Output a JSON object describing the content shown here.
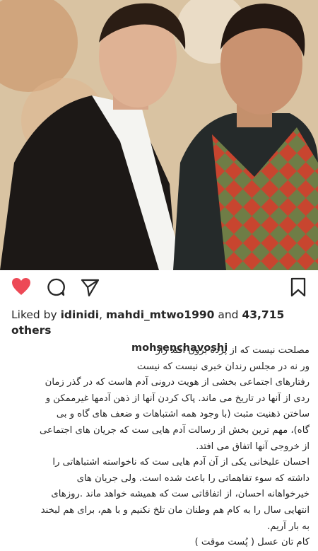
{
  "post": {
    "likes_prefix": "Liked by ",
    "liker_1": "idinidi",
    "sep": ", ",
    "liker_2": "mahdi_mtwo1990",
    "and": " and ",
    "count": "43,715",
    "others": "others",
    "username": "mohsenchavoshi",
    "caption_lines": [
      "مصلحت نیست که از پرده برون افتد راز",
      "ور نه در مجلس رندان خبری نیست که نیست",
      "رفتارهای اجتماعی بخشی از هویت درونی آدم هاست که در گذر زمان",
      "ردی از آنها در تاریخ می ماند. پاک کردن آنها از ذهن آدمها غیرممکن و",
      "ساختن ذهنیت مثبت (با وجود همه اشتباهات و ضعف های گاه و بی",
      "گاه)، مهم ترین بخش از رسالت آدم هایی ست که جریان های اجتماعی",
      "از خروجی آنها اتفاق می افتد.",
      "احسان علیخانی یکی از آن آدم هایی ست که ناخواسته اشتباهاتی را",
      "داشته که سوء تفاهماتی را باعث شده است. ولی جریان های",
      "خیرخواهانه احسان، از اتفاقاتی ست که همیشه خواهد ماند .روزهای",
      "انتهایی سال را به کام هم وطنان مان تلخ نکنیم و با هم، برای هم لبخند",
      "به بار آریم.",
      "کام تان عسل ( پُست موقت )"
    ]
  },
  "colors": {
    "heart": "#ed4956",
    "text": "#262626"
  },
  "icons": [
    "heart-icon",
    "comment-icon",
    "share-icon",
    "bookmark-icon"
  ]
}
